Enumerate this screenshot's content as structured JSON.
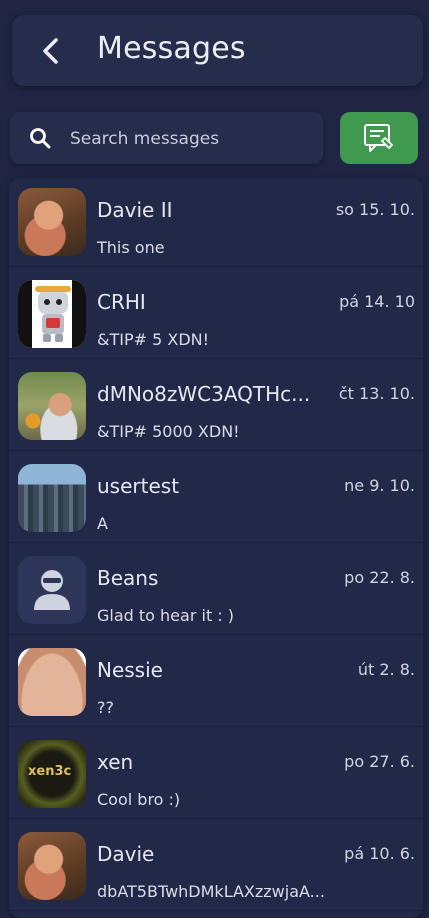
{
  "header": {
    "title": "Messages",
    "back_icon": "chevron-left-icon"
  },
  "search": {
    "placeholder": "Search messages",
    "value": "",
    "icon": "search-icon"
  },
  "new_message_button": {
    "icon": "compose-message-icon",
    "color": "#3f9a4f"
  },
  "conversations": [
    {
      "name": "Davie II",
      "date": "so 15. 10.",
      "preview": "This one",
      "avatar": "photo-avatar"
    },
    {
      "name": "CRHI",
      "date": "pá 14. 10",
      "preview": "&TIP# 5 XDN!",
      "avatar": "robot-avatar"
    },
    {
      "name": "dMNo8zWC3AQTHc...",
      "date": "čt 13. 10.",
      "preview": "&TIP# 5000 XDN!",
      "avatar": "photo-avatar"
    },
    {
      "name": "usertest",
      "date": "ne 9. 10.",
      "preview": "A",
      "avatar": "photo-avatar"
    },
    {
      "name": "Beans",
      "date": "po 22. 8.",
      "preview": "Glad to hear it : )",
      "avatar": "default-user-avatar"
    },
    {
      "name": "Nessie",
      "date": "út 2. 8.",
      "preview": "??",
      "avatar": "photo-avatar"
    },
    {
      "name": "xen",
      "date": "po 27. 6.",
      "preview": "Cool bro :)",
      "avatar": "xen-logo-avatar",
      "avatar_text": "xen3c"
    },
    {
      "name": "Davie",
      "date": "pá 10. 6.",
      "preview": "dbAT5BTwhDMkLAXzzwjaA...",
      "avatar": "photo-avatar"
    }
  ]
}
